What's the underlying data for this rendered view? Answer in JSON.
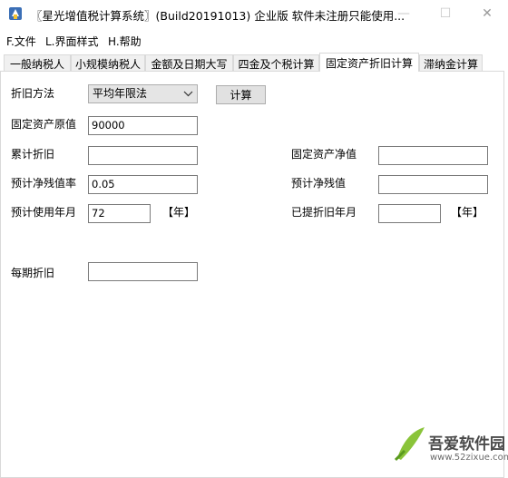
{
  "window": {
    "title": "〖星光增值税计算系统〗(Build20191013) 企业版 软件未注册只能使用...",
    "minimize_glyph": "—",
    "maximize_glyph": "☐",
    "close_glyph": "✕"
  },
  "menu": {
    "items": [
      "F.文件",
      "L.界面样式",
      "H.帮助"
    ]
  },
  "tabs": [
    {
      "label": "一般纳税人"
    },
    {
      "label": "小规模纳税人"
    },
    {
      "label": "金额及日期大写"
    },
    {
      "label": "四金及个税计算"
    },
    {
      "label": "固定资产折旧计算",
      "active": true
    },
    {
      "label": "滞纳金计算"
    }
  ],
  "form": {
    "method_label": "折旧方法",
    "method_value": "平均年限法",
    "calc_button": "计算",
    "original_value_label": "固定资产原值",
    "original_value": "90000",
    "accum_depr_label": "累计折旧",
    "accum_depr_value": "",
    "net_value_label": "固定资产净值",
    "net_value_value": "",
    "residual_rate_label": "预计净残值率",
    "residual_rate_value": "0.05",
    "residual_value_label": "预计净残值",
    "residual_value_value": "",
    "use_months_label": "预计使用年月",
    "use_months_value": "72",
    "use_unit": "【年】",
    "depr_months_label": "已提折旧年月",
    "depr_months_value": "",
    "depr_unit": "【年】",
    "period_depr_label": "每期折旧",
    "period_depr_value": ""
  },
  "watermark": {
    "site_name": "吾爱软件园",
    "url": "www.52zixue.com"
  }
}
